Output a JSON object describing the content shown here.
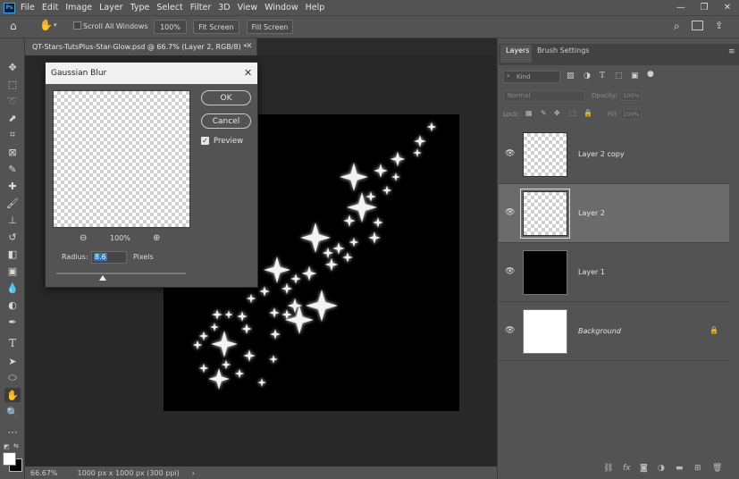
{
  "app": {
    "logo": "Ps"
  },
  "menu": [
    "File",
    "Edit",
    "Image",
    "Layer",
    "Type",
    "Select",
    "Filter",
    "3D",
    "View",
    "Window",
    "Help"
  ],
  "options_bar": {
    "scroll_all_windows": "Scroll All Windows",
    "zoom_btn": "100%",
    "fit_screen": "Fit Screen",
    "fill_screen": "Fill Screen"
  },
  "document": {
    "tab_title": "QT-Stars-TutsPlus-Star-Glow.psd @ 66.7% (Layer 2, RGB/8) *",
    "zoom": "66.67%",
    "info": "1000 px x 1000 px (300 ppi)"
  },
  "dialog": {
    "title": "Gaussian Blur",
    "ok": "OK",
    "cancel": "Cancel",
    "preview_label": "Preview",
    "preview_checked": true,
    "preview_zoom": "100%",
    "radius_label": "Radius:",
    "radius_value": "8.6",
    "radius_unit": "Pixels"
  },
  "panels": {
    "tabs": [
      "Layers",
      "Brush Settings"
    ],
    "filter_kind": "Kind",
    "blend_mode": "Normal",
    "opacity_label": "Opacity:",
    "opacity_value": "100%",
    "lock_label": "Lock:",
    "fill_label": "Fill:",
    "fill_value": "100%",
    "layers": [
      {
        "name": "Layer 2 copy",
        "thumb": "transparent",
        "selected": false
      },
      {
        "name": "Layer 2",
        "thumb": "transparent",
        "selected": true
      },
      {
        "name": "Layer 1",
        "thumb": "black",
        "selected": false
      },
      {
        "name": "Background",
        "thumb": "white",
        "selected": false,
        "locked": true
      }
    ]
  },
  "colors": {
    "ui_bg": "#535353",
    "canvas_bg": "#282828",
    "selected_layer": "#6b6b6b",
    "accent": "#31a8ff"
  }
}
